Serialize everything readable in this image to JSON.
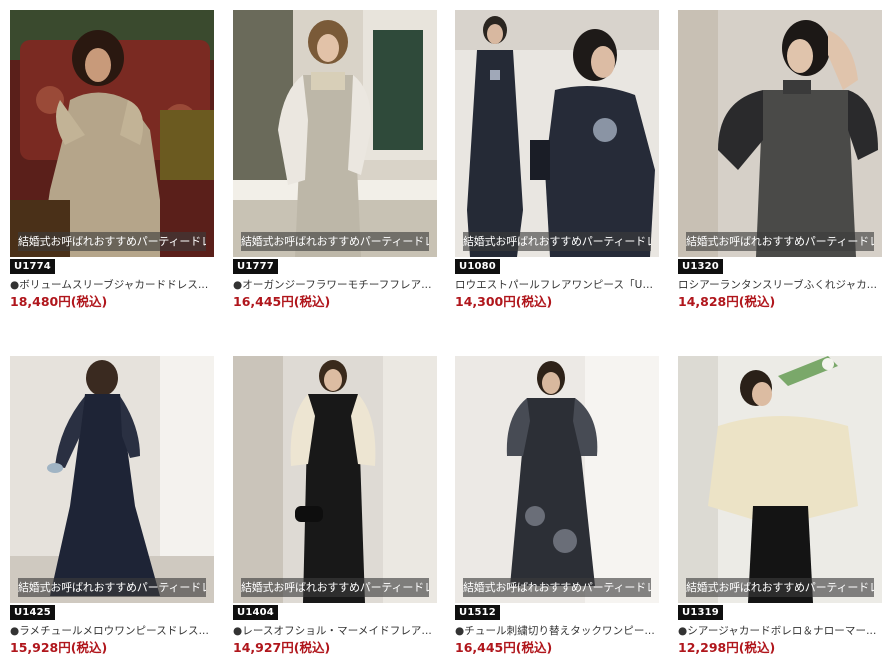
{
  "colors": {
    "price": "#b0161c",
    "badge_bg": "#0f0f0f",
    "overlay_bg": "#3c3c3c"
  },
  "products": [
    {
      "image_label": "結婚式お呼ばれおすすめパーティードレス",
      "code": "U1774",
      "name": "●ボリュームスリーブジャカードドレス...",
      "price": "18,480円(税込)"
    },
    {
      "image_label": "結婚式お呼ばれおすすめパーティードレス",
      "code": "U1777",
      "name": "●オーガンジーフラワーモチーフフレア...",
      "price": "16,445円(税込)"
    },
    {
      "image_label": "結婚式お呼ばれおすすめパーティードレス",
      "code": "U1080",
      "name": "ロウエストパールフレアワンピース「U1...",
      "price": "14,300円(税込)"
    },
    {
      "image_label": "結婚式お呼ばれおすすめパーティードレス",
      "code": "U1320",
      "name": "ロシアーランタンスリーブふくれジャカ...",
      "price": "14,828円(税込)"
    },
    {
      "image_label": "結婚式お呼ばれおすすめパーティードレス",
      "code": "U1425",
      "name": "●ラメチュールメロウワンピースドレス...",
      "price": "15,928円(税込)"
    },
    {
      "image_label": "結婚式お呼ばれおすすめパーティードレス",
      "code": "U1404",
      "name": "●レースオフショル・マーメイドフレア...",
      "price": "14,927円(税込)"
    },
    {
      "image_label": "結婚式お呼ばれおすすめパーティードレス",
      "code": "U1512",
      "name": "●チュール刺繍切り替えタックワンピー...",
      "price": "16,445円(税込)"
    },
    {
      "image_label": "結婚式お呼ばれおすすめパーティードレス",
      "code": "U1319",
      "name": "●シアージャカードボレロ＆ナローマー...",
      "price": "12,298円(税込)"
    }
  ]
}
